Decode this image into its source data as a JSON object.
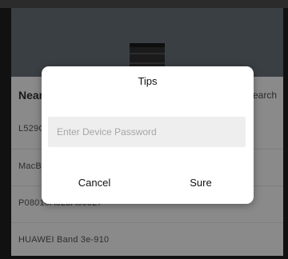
{
  "panel": {
    "title": "Near",
    "search_label": "Search"
  },
  "devices": [
    {
      "name": "L529C"
    },
    {
      "name": "MacBook"
    },
    {
      "name": "P08010A023A00027"
    },
    {
      "name": "HUAWEI Band 3e-910"
    }
  ],
  "dialog": {
    "title": "Tips",
    "password_placeholder": "Enter Device Password",
    "password_value": "",
    "cancel_label": "Cancel",
    "sure_label": "Sure"
  },
  "colors": {
    "overlay_dim": "#8a8a8a",
    "dialog_bg": "#ffffff",
    "input_bg": "#eeeeee",
    "placeholder": "#a6a6a6"
  },
  "icons": {
    "device_image": "watch-band-image"
  }
}
